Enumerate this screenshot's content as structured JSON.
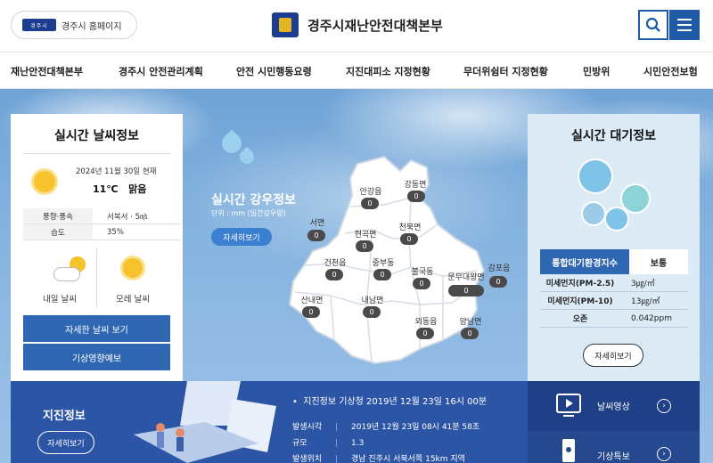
{
  "header": {
    "home_logo_text": "경주시",
    "home_label": "경주시 홈페이지",
    "site_title": "경주시재난안전대책본부"
  },
  "nav": [
    "재난안전대책본부",
    "경주시 안전관리계획",
    "안전 시민행동요령",
    "지진대피소 지정현황",
    "무더위쉼터 지정현황",
    "민방위",
    "시민안전보험"
  ],
  "weather": {
    "title": "실시간 날씨정보",
    "date": "2024년 11월 30일 현재",
    "temp": "11℃",
    "condition": "맑음",
    "rows": [
      {
        "k": "풍향·풍속",
        "v": "서북서 · 5㎧"
      },
      {
        "k": "습도",
        "v": "35%"
      }
    ],
    "tomorrow": "내일 날씨",
    "day_after": "모레 날씨",
    "detail_btn": "자세한 날씨 보기",
    "impact_btn": "기상영향예보"
  },
  "rain": {
    "title": "실시간 강우정보",
    "unit": "단위 : mm (일간강우량)",
    "detail_btn": "자세히보기",
    "districts": [
      {
        "name": "강동면",
        "value": "0"
      },
      {
        "name": "안강읍",
        "value": "0"
      },
      {
        "name": "서면",
        "value": "0"
      },
      {
        "name": "현곡면",
        "value": "0"
      },
      {
        "name": "천북면",
        "value": "0"
      },
      {
        "name": "건천읍",
        "value": "0"
      },
      {
        "name": "중부동",
        "value": "0"
      },
      {
        "name": "불국동",
        "value": "0"
      },
      {
        "name": "문무대왕면",
        "value": "0"
      },
      {
        "name": "감포읍",
        "value": "0"
      },
      {
        "name": "산내면",
        "value": "0"
      },
      {
        "name": "내남면",
        "value": "0"
      },
      {
        "name": "외동읍",
        "value": "0"
      },
      {
        "name": "양남면",
        "value": "0"
      }
    ]
  },
  "air": {
    "title": "실시간 대기정보",
    "index_label": "통합대기환경지수",
    "index_value": "보통",
    "rows": [
      {
        "k": "미세먼지(PM-2.5)",
        "v": "3㎍/㎥"
      },
      {
        "k": "미세먼지(PM-10)",
        "v": "13㎍/㎥"
      },
      {
        "k": "오존",
        "v": "0.042ppm"
      }
    ],
    "detail_btn": "자세히보기"
  },
  "quake": {
    "title": "지진정보",
    "detail_btn": "자세히보기",
    "headline": "지진정보 기상청 2019년 12월 23일 16시 00분",
    "rows": [
      {
        "k": "발생시각",
        "v": "2019년 12월 23일 08시 41분 58초"
      },
      {
        "k": "규모",
        "v": "1.3"
      },
      {
        "k": "발생위치",
        "v": "경남 진주시 서북서쪽 15km 지역"
      }
    ]
  },
  "side_links": [
    "날씨영상",
    "기상특보"
  ],
  "colors": {
    "primary": "#2f67b3",
    "dark_blue": "#1f3f86",
    "quake_bg": "#2d55a6",
    "air_bg": "#dcebf6"
  }
}
